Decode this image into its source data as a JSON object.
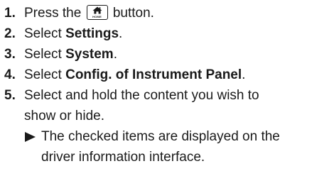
{
  "steps": [
    {
      "num": "1.",
      "pre": "Press the",
      "icon": "home-icon",
      "button_label": "HOME",
      "post": "button."
    },
    {
      "num": "2.",
      "pre": "Select",
      "bold": "Settings",
      "post": "."
    },
    {
      "num": "3.",
      "pre": "Select",
      "bold": "System",
      "post": "."
    },
    {
      "num": "4.",
      "pre": "Select",
      "bold": "Config. of Instrument Panel",
      "post": "."
    },
    {
      "num": "5.",
      "line1": "Select and hold the content you wish to",
      "line2": "show or hide.",
      "result_icon": "right-triangle-icon",
      "result_line1": "The checked items are displayed on the",
      "result_line2": "driver information interface."
    }
  ]
}
